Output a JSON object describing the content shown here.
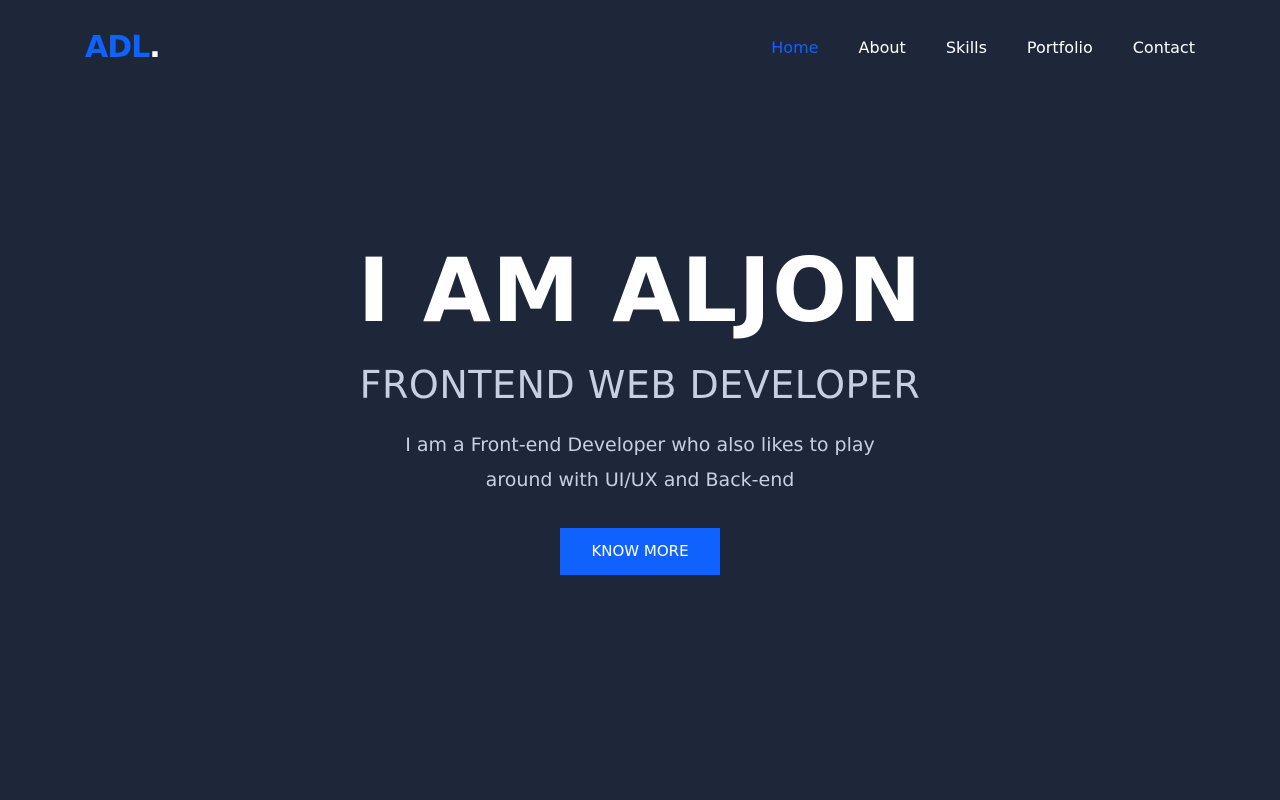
{
  "brand": {
    "logo_text": "ADL",
    "logo_dot": ".",
    "accent_color": "#0f62fe",
    "background_color": "#1d2739"
  },
  "nav": {
    "items": [
      {
        "label": "Home",
        "active": true
      },
      {
        "label": "About",
        "active": false
      },
      {
        "label": "Skills",
        "active": false
      },
      {
        "label": "Portfolio",
        "active": false
      },
      {
        "label": "Contact",
        "active": false
      }
    ]
  },
  "hero": {
    "title": "I AM ALJON",
    "subtitle": "FRONTEND WEB DEVELOPER",
    "description": "I am a Front-end Developer who also likes to play around with UI/UX and Back-end",
    "cta_label": "KNOW MORE"
  }
}
